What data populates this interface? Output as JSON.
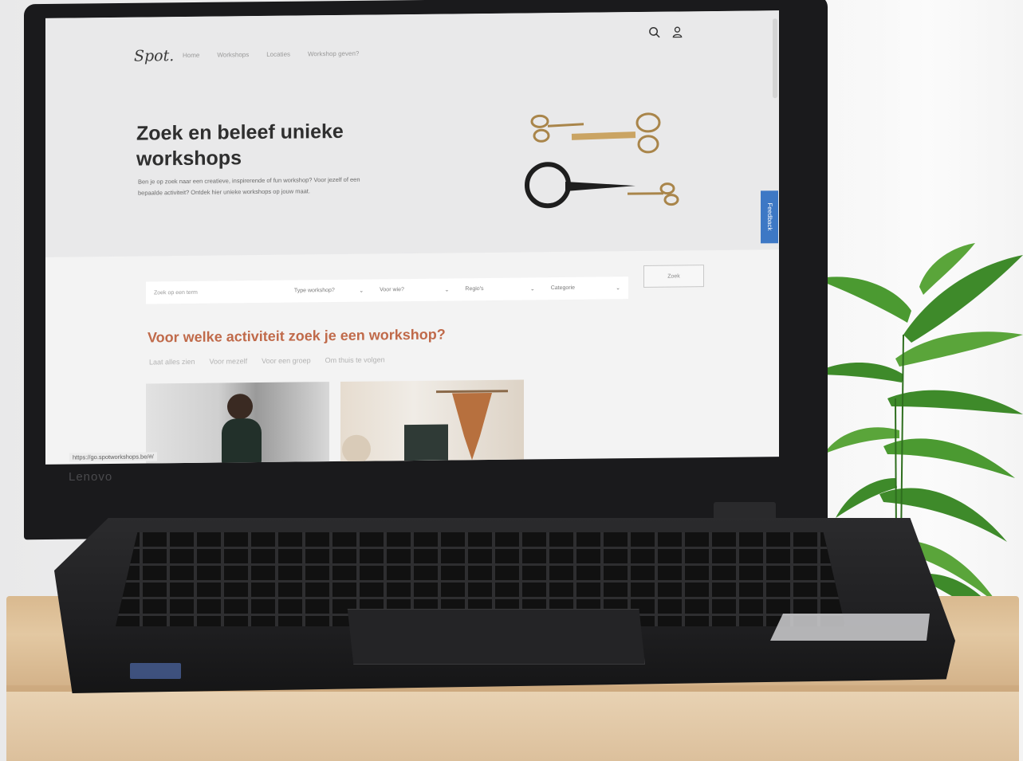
{
  "brand": {
    "laptop": "Lenovo"
  },
  "site": {
    "logo": "Spot.",
    "nav": [
      "Home",
      "Workshops",
      "Locaties",
      "Workshop geven?"
    ],
    "hero_title": "Zoek en beleef unieke workshops",
    "hero_text": "Ben je op zoek naar een creatieve, inspirerende of fun workshop? Voor jezelf of een bepaalde activiteit? Ontdek hier unieke workshops op jouw maat.",
    "feedback_label": "Feedback",
    "search": {
      "placeholder": "Zoek op een term",
      "type": "Type workshop?",
      "who": "Voor wie?",
      "region": "Regio's",
      "category": "Categorie",
      "button": "Zoek"
    },
    "section_title": "Voor welke activiteit zoek je een workshop?",
    "filters": [
      "Laat alles zien",
      "Voor mezelf",
      "Voor een groep",
      "Om thuis te volgen"
    ],
    "status_url": "https://go.spotworkshops.be/#/"
  },
  "colors": {
    "accent": "#c06a4a",
    "feedback": "#3d78c5"
  },
  "icons": [
    "search-icon",
    "user-icon"
  ]
}
